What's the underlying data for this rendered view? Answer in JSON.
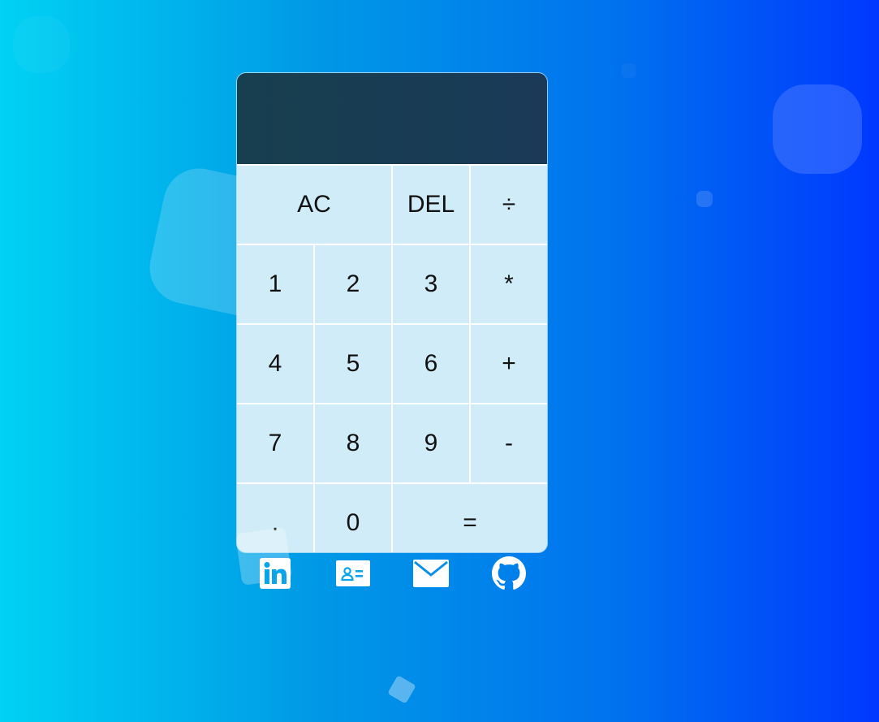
{
  "display": {
    "value": ""
  },
  "keys": [
    {
      "label": "AC",
      "name": "clear-all-button",
      "span": 2
    },
    {
      "label": "DEL",
      "name": "delete-button",
      "span": 1
    },
    {
      "label": "÷",
      "name": "divide-button",
      "span": 1
    },
    {
      "label": "1",
      "name": "digit-1-button",
      "span": 1
    },
    {
      "label": "2",
      "name": "digit-2-button",
      "span": 1
    },
    {
      "label": "3",
      "name": "digit-3-button",
      "span": 1
    },
    {
      "label": "*",
      "name": "multiply-button",
      "span": 1
    },
    {
      "label": "4",
      "name": "digit-4-button",
      "span": 1
    },
    {
      "label": "5",
      "name": "digit-5-button",
      "span": 1
    },
    {
      "label": "6",
      "name": "digit-6-button",
      "span": 1
    },
    {
      "label": "+",
      "name": "add-button",
      "span": 1
    },
    {
      "label": "7",
      "name": "digit-7-button",
      "span": 1
    },
    {
      "label": "8",
      "name": "digit-8-button",
      "span": 1
    },
    {
      "label": "9",
      "name": "digit-9-button",
      "span": 1
    },
    {
      "label": "-",
      "name": "subtract-button",
      "span": 1
    },
    {
      "label": ".",
      "name": "decimal-point-button",
      "span": 1
    },
    {
      "label": "0",
      "name": "digit-0-button",
      "span": 1
    },
    {
      "label": "=",
      "name": "equals-button",
      "span": 2
    }
  ],
  "social": [
    {
      "icon": "linkedin-icon"
    },
    {
      "icon": "contact-card-icon"
    },
    {
      "icon": "mail-icon"
    },
    {
      "icon": "github-icon"
    }
  ],
  "colors": {
    "background_start": "#00d2f4",
    "background_end": "#0038ff",
    "display_background": "#173f4f",
    "key_background": "#cdebf8",
    "icon_color": "#ffffff"
  }
}
